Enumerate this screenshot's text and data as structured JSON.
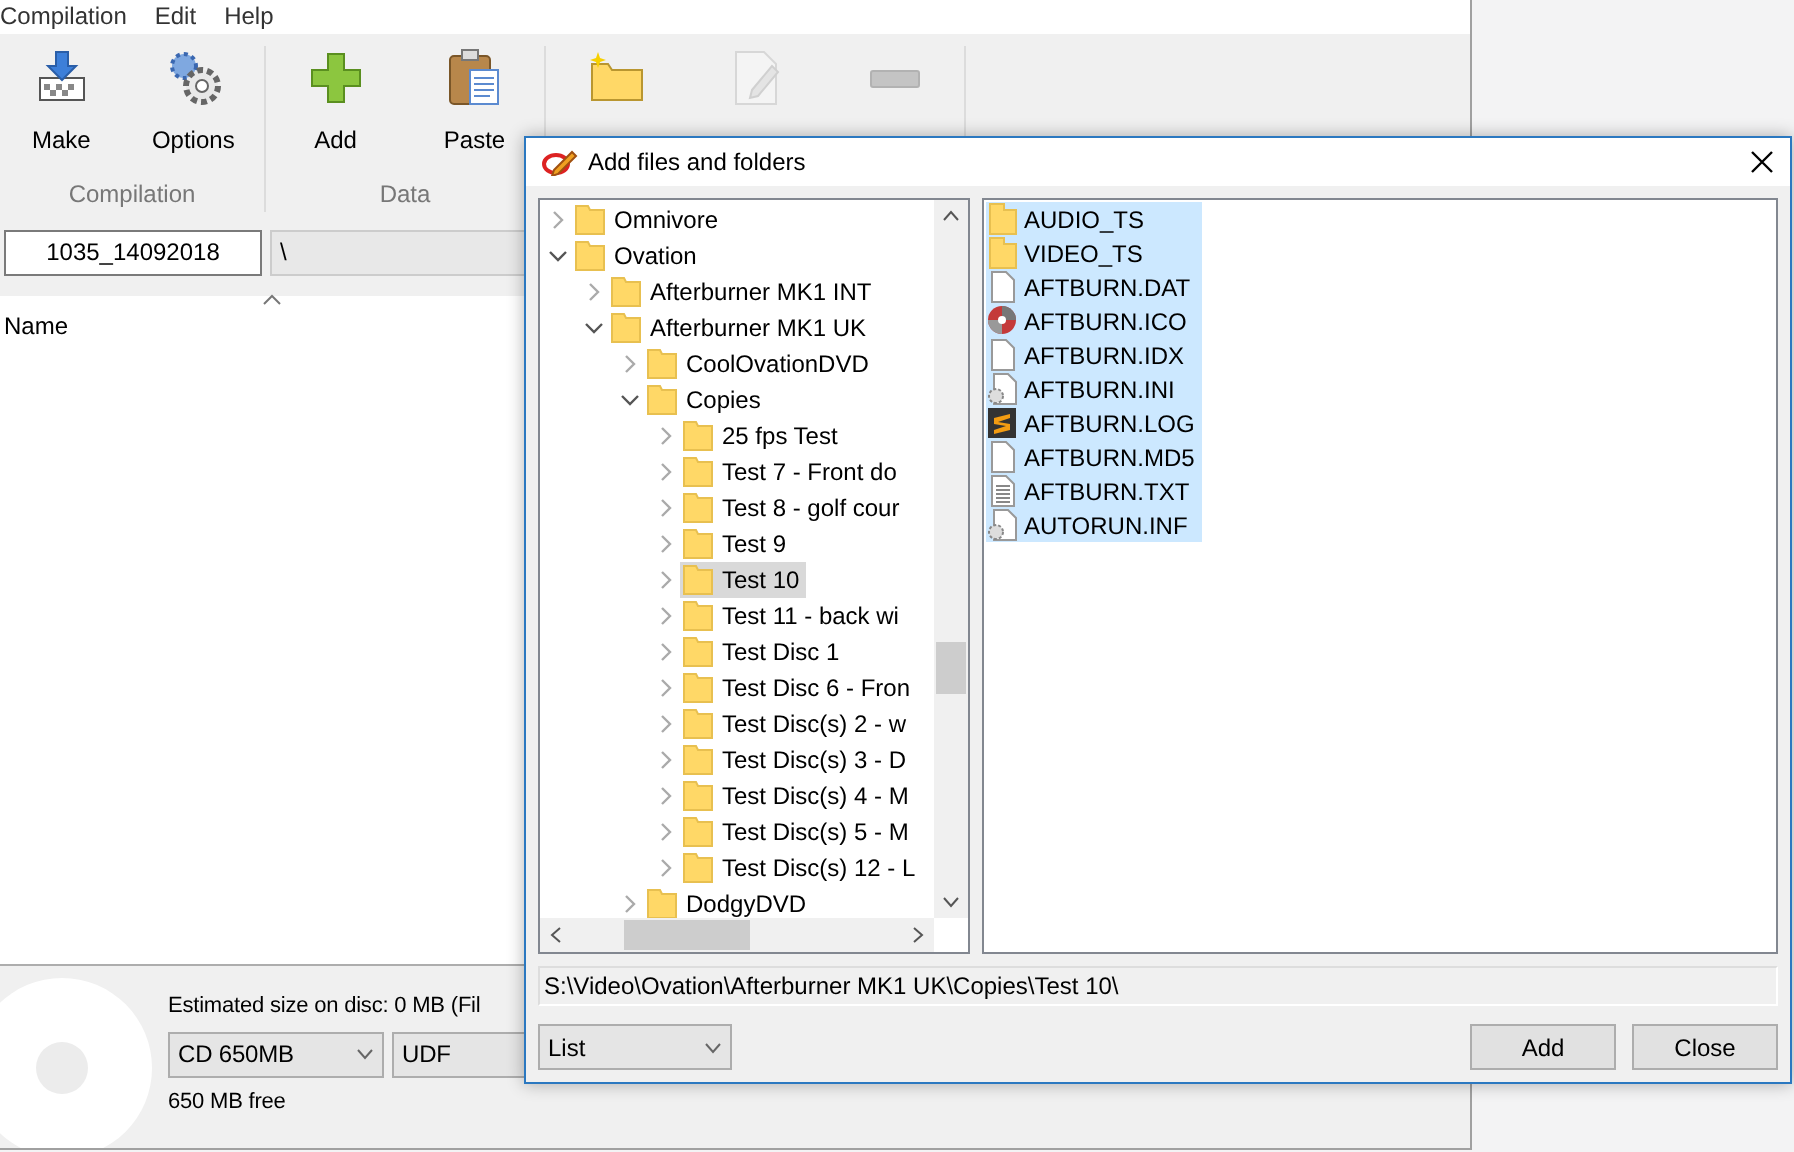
{
  "main_window": {
    "menu": [
      "Compilation",
      "Edit",
      "Help"
    ],
    "ribbon_groups": [
      {
        "label": "Compilation",
        "buttons": [
          {
            "kind": "make",
            "label": "Make",
            "disabled": false
          },
          {
            "kind": "options",
            "label": "Options",
            "disabled": false
          }
        ]
      },
      {
        "label": "Data",
        "buttons": [
          {
            "kind": "add",
            "label": "Add",
            "disabled": false
          },
          {
            "kind": "paste",
            "label": "Paste",
            "disabled": false
          }
        ]
      },
      {
        "buttons": [
          {
            "kind": "new-folder",
            "disabled": false
          },
          {
            "kind": "properties",
            "disabled": true
          },
          {
            "kind": "remove",
            "disabled": true
          }
        ]
      }
    ],
    "name_field": "1035_14092018",
    "path_field": "\\",
    "column": "Name",
    "estimate": "Estimated size on disc: 0 MB (Fil",
    "disc_type": "CD 650MB",
    "file_system": "UDF",
    "free": "650 MB free"
  },
  "dialog": {
    "title": "Add files and folders",
    "tree": [
      {
        "label": "Omnivore",
        "expanded": false,
        "selected": false
      },
      {
        "label": "Ovation",
        "expanded": true,
        "selected": false,
        "children": [
          {
            "label": "Afterburner MK1 INT",
            "expanded": false,
            "selected": false
          },
          {
            "label": "Afterburner MK1 UK",
            "expanded": true,
            "selected": false,
            "children": [
              {
                "label": "CoolOvationDVD",
                "expanded": false,
                "selected": false
              },
              {
                "label": "Copies",
                "expanded": true,
                "selected": false,
                "children": [
                  {
                    "label": "25 fps Test",
                    "expanded": false,
                    "selected": false
                  },
                  {
                    "label": "Test 7 - Front do",
                    "expanded": false,
                    "selected": false
                  },
                  {
                    "label": "Test 8 - golf cour",
                    "expanded": false,
                    "selected": false
                  },
                  {
                    "label": "Test 9",
                    "expanded": false,
                    "selected": false
                  },
                  {
                    "label": "Test 10",
                    "expanded": false,
                    "selected": true
                  },
                  {
                    "label": "Test 11 - back wi",
                    "expanded": false,
                    "selected": false
                  },
                  {
                    "label": "Test Disc 1",
                    "expanded": false,
                    "selected": false
                  },
                  {
                    "label": "Test Disc 6 - Fron",
                    "expanded": false,
                    "selected": false
                  },
                  {
                    "label": "Test Disc(s) 2 - w",
                    "expanded": false,
                    "selected": false
                  },
                  {
                    "label": "Test Disc(s) 3 - D",
                    "expanded": false,
                    "selected": false
                  },
                  {
                    "label": "Test Disc(s) 4 - M",
                    "expanded": false,
                    "selected": false
                  },
                  {
                    "label": "Test Disc(s) 5 - M",
                    "expanded": false,
                    "selected": false
                  },
                  {
                    "label": "Test Disc(s) 12 - L",
                    "expanded": false,
                    "selected": false
                  }
                ]
              },
              {
                "label": "DodgyDVD",
                "expanded": false,
                "selected": false
              }
            ]
          }
        ]
      }
    ],
    "files": [
      {
        "name": "AUDIO_TS",
        "kind": "folder",
        "selected": true
      },
      {
        "name": "VIDEO_TS",
        "kind": "folder",
        "selected": true
      },
      {
        "name": "AFTBURN.DAT",
        "kind": "file",
        "selected": true
      },
      {
        "name": "AFTBURN.ICO",
        "kind": "disc",
        "selected": true
      },
      {
        "name": "AFTBURN.IDX",
        "kind": "file",
        "selected": true
      },
      {
        "name": "AFTBURN.INI",
        "kind": "settings",
        "selected": true
      },
      {
        "name": "AFTBURN.LOG",
        "kind": "app",
        "selected": true
      },
      {
        "name": "AFTBURN.MD5",
        "kind": "file",
        "selected": true
      },
      {
        "name": "AFTBURN.TXT",
        "kind": "text",
        "selected": true
      },
      {
        "name": "AUTORUN.INF",
        "kind": "settings",
        "selected": true
      }
    ],
    "path": "S:\\Video\\Ovation\\Afterburner MK1 UK\\Copies\\Test 10\\",
    "view": "List",
    "buttons": [
      "Add",
      "Close"
    ]
  }
}
